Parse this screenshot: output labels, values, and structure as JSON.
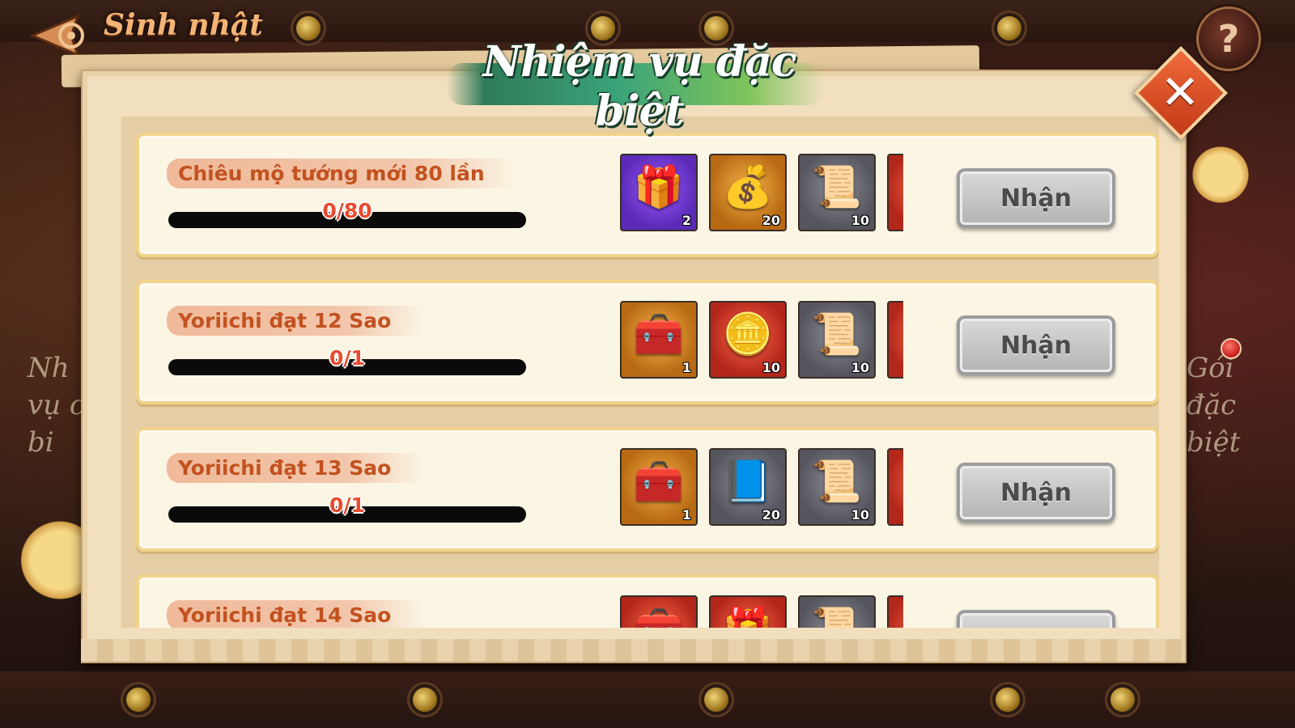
{
  "header": {
    "back_title": "Sinh nhật",
    "help_label": "?"
  },
  "dialog": {
    "title": "Nhiệm vụ đặc biệt",
    "close_label": "✕"
  },
  "background": {
    "left_text": "Nh\nvụ c\nbi",
    "right_text": "Gói\nđặc\nbiệt"
  },
  "tasks": [
    {
      "label": "Chiêu mộ tướng mới 80 lần",
      "progress_text": "0/80",
      "progress_fraction": 0,
      "claim_label": "Nhận",
      "rewards": [
        {
          "icon": "treasure-box-icon",
          "glyph": "🎁",
          "style": "purple",
          "qty": "2"
        },
        {
          "icon": "money-bag-icon",
          "glyph": "💰",
          "style": "orange",
          "qty": "20"
        },
        {
          "icon": "scroll-icon",
          "glyph": "📜",
          "style": "gray",
          "qty": "10"
        },
        {
          "icon": "gold-ingot-icon",
          "glyph": "🏮",
          "style": "red",
          "qty": ""
        }
      ]
    },
    {
      "label": "Yoriichi đạt 12 Sao",
      "progress_text": "0/1",
      "progress_fraction": 0,
      "claim_label": "Nhận",
      "rewards": [
        {
          "icon": "chest-icon",
          "glyph": "🧰",
          "style": "orange",
          "qty": "1"
        },
        {
          "icon": "coin-pile-icon",
          "glyph": "🪙",
          "style": "red",
          "qty": "10"
        },
        {
          "icon": "scroll-icon",
          "glyph": "📜",
          "style": "gray",
          "qty": "10"
        },
        {
          "icon": "gold-ingot-icon",
          "glyph": "🏮",
          "style": "red",
          "qty": ""
        }
      ]
    },
    {
      "label": "Yoriichi đạt 13 Sao",
      "progress_text": "0/1",
      "progress_fraction": 0,
      "claim_label": "Nhận",
      "rewards": [
        {
          "icon": "chest-icon",
          "glyph": "🧰",
          "style": "orange",
          "qty": "1"
        },
        {
          "icon": "skill-book-icon",
          "glyph": "📘",
          "style": "gray",
          "qty": "20"
        },
        {
          "icon": "scroll-icon",
          "glyph": "📜",
          "style": "gray",
          "qty": "10"
        },
        {
          "icon": "gold-ingot-icon",
          "glyph": "🏮",
          "style": "red",
          "qty": ""
        }
      ]
    },
    {
      "label": "Yoriichi đạt 14 Sao",
      "progress_text": "",
      "progress_fraction": 0,
      "claim_label": "",
      "rewards": [
        {
          "icon": "chest-icon",
          "glyph": "🧰",
          "style": "red",
          "qty": ""
        },
        {
          "icon": "treasure-box-icon",
          "glyph": "🎁",
          "style": "red",
          "qty": ""
        },
        {
          "icon": "scroll-icon",
          "glyph": "📜",
          "style": "gray",
          "qty": ""
        },
        {
          "icon": "gold-ingot-icon",
          "glyph": "🏮",
          "style": "red",
          "qty": ""
        }
      ]
    }
  ],
  "colors": {
    "task_label": "#c2521f",
    "progress_text": "#e84b2f",
    "title_green": "#3aa37a",
    "close_orange": "#f06a3b"
  }
}
